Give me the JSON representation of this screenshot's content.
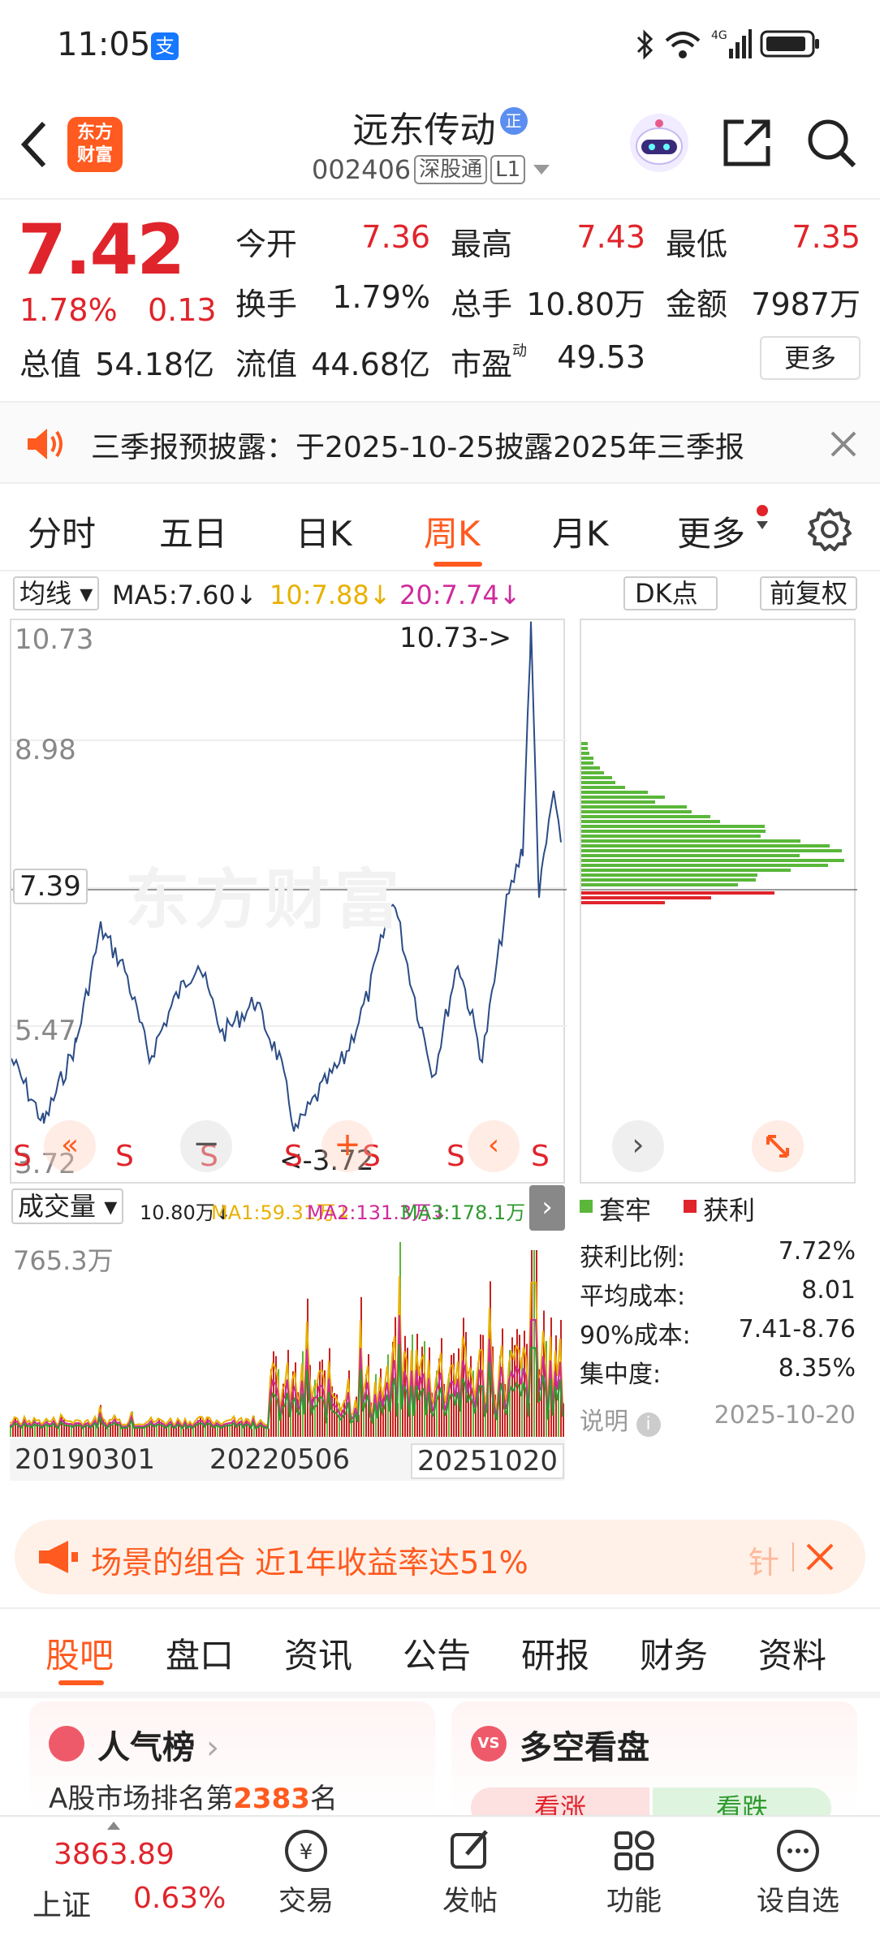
{
  "status": {
    "time": "11:05",
    "alipay_icon": "支"
  },
  "header": {
    "title": "远东传动",
    "title_badge": "正",
    "code": "002406",
    "tags": [
      "深股通",
      "L1"
    ],
    "logo_line1": "东方",
    "logo_line2": "财富"
  },
  "quote": {
    "price": "7.42",
    "pct": "1.78%",
    "chg": "0.13",
    "fields": [
      {
        "label": "今开",
        "value": "7.36",
        "red": true
      },
      {
        "label": "最高",
        "value": "7.43",
        "red": true
      },
      {
        "label": "最低",
        "value": "7.35",
        "red": true
      },
      {
        "label": "换手",
        "value": "1.79%",
        "red": false
      },
      {
        "label": "总手",
        "value": "10.80万",
        "red": false
      },
      {
        "label": "金额",
        "value": "7987万",
        "red": false
      },
      {
        "label": "总值",
        "value": "54.18亿",
        "red": false
      },
      {
        "label": "流值",
        "value": "44.68亿",
        "red": false
      },
      {
        "label": "市盈",
        "value": "49.53",
        "red": false
      }
    ],
    "pe_sup": "动",
    "more": "更多"
  },
  "notice": {
    "text": "三季报预披露：于2025-10-25披露2025年三季报"
  },
  "tabs": [
    "分时",
    "五日",
    "日K",
    "周K",
    "月K",
    "更多"
  ],
  "active_tab_index": 3,
  "ma": {
    "selector": "均线",
    "ma5": "MA5:7.60",
    "ma10": "10:7.88",
    "ma20": "20:7.74",
    "dk": "DK点",
    "fq": "前复权",
    "down": "↓"
  },
  "chart": {
    "y_top": "10.73",
    "y_mid1": "8.98",
    "y_cur": "7.39",
    "y_mid2": "5.47",
    "y_bot": "3.72",
    "max_label": "10.73->",
    "min_label": "<-3.72",
    "watermark": "东方财富",
    "signal": "S"
  },
  "volume": {
    "selector": "成交量",
    "vol": "10.80万",
    "ma1": "MA1:59.31万",
    "ma2": "MA2:131.3万",
    "ma3": "MA3:178.1万",
    "ymax": "765.3万",
    "dates": [
      "20190301",
      "20220506",
      "20251020"
    ]
  },
  "chips": {
    "legend_trap": "套牢",
    "legend_profit": "获利",
    "rows": [
      {
        "label": "获利比例:",
        "value": "7.72%"
      },
      {
        "label": "平均成本:",
        "value": "8.01"
      },
      {
        "label": "90%成本:",
        "value": "7.41-8.76"
      },
      {
        "label": "集中度:",
        "value": "8.35%"
      }
    ],
    "note": "说明",
    "date": "2025-10-20"
  },
  "banner": {
    "text": "场景的组合 近1年收益率达51%",
    "tail": "针"
  },
  "bottom_tabs": [
    "股吧",
    "盘口",
    "资讯",
    "公告",
    "研报",
    "财务",
    "资料"
  ],
  "cards": {
    "rank_title": "人气榜",
    "rank_text_pre": "A股市场排名第",
    "rank_num": "2383",
    "rank_text_post": "名",
    "ls_title": "多空看盘",
    "bull": "看涨",
    "bear": "看跌"
  },
  "nav": {
    "index_value": "3863.89",
    "index_name": "上证",
    "index_pct": "0.63%",
    "items": [
      "交易",
      "发帖",
      "功能",
      "设自选"
    ]
  },
  "colors": {
    "red": "#e0242b",
    "accent": "#ff5a1f",
    "green": "#5ab73a",
    "line": "#2b4c86",
    "ma_yellow": "#e8b100",
    "ma_pink": "#cf2b9c"
  }
}
